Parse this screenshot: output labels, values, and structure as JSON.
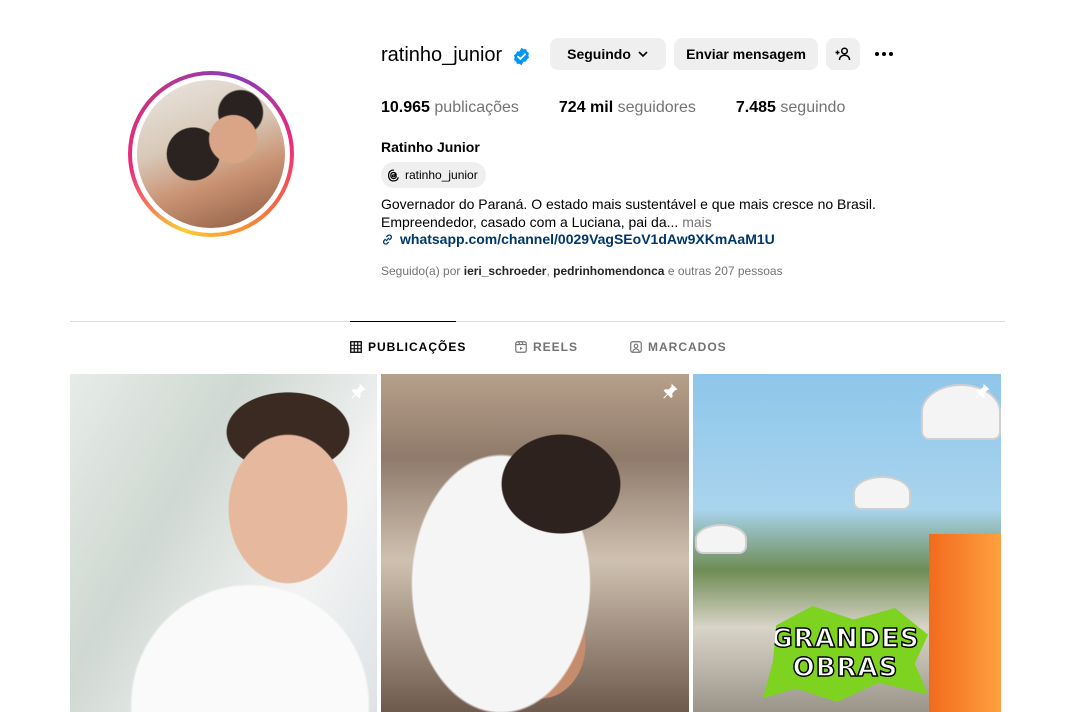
{
  "profile": {
    "username": "ratinho_junior",
    "full_name": "Ratinho Junior",
    "threads_handle": "ratinho_junior",
    "bio_line1": "Governador do Paraná. O estado mais sustentável e que mais cresce no Brasil.",
    "bio_line2": "Empreendedor, casado com a Luciana, pai da...",
    "bio_more": "mais",
    "link": "whatsapp.com/channel/0029VagSEoV1dAw9XKmAaM1U"
  },
  "actions": {
    "following_label": "Seguindo",
    "message_label": "Enviar mensagem"
  },
  "stats": {
    "posts_count": "10.965",
    "posts_label": "publicações",
    "followers_count": "724 mil",
    "followers_label": "seguidores",
    "following_count": "7.485",
    "following_label": "seguindo"
  },
  "followed_by": {
    "prefix": "Seguido(a) por",
    "user1": "ieri_schroeder",
    "separator": ",",
    "user2": "pedrinhomendonca",
    "suffix": "e outras 207 pessoas"
  },
  "tabs": [
    {
      "label": "PUBLICAÇÕES",
      "icon": "grid-icon",
      "active": true
    },
    {
      "label": "REELS",
      "icon": "reels-icon",
      "active": false
    },
    {
      "label": "MARCADOS",
      "icon": "tagged-icon",
      "active": false
    }
  ],
  "posts": [
    {
      "pinned": true
    },
    {
      "pinned": true
    },
    {
      "pinned": true,
      "overlay_line1": "GRANDES",
      "overlay_line2": "OBRAS"
    }
  ],
  "colors": {
    "verified": "#0095f6",
    "link": "#00376b",
    "muted": "#737373",
    "button_bg": "#efefef"
  }
}
